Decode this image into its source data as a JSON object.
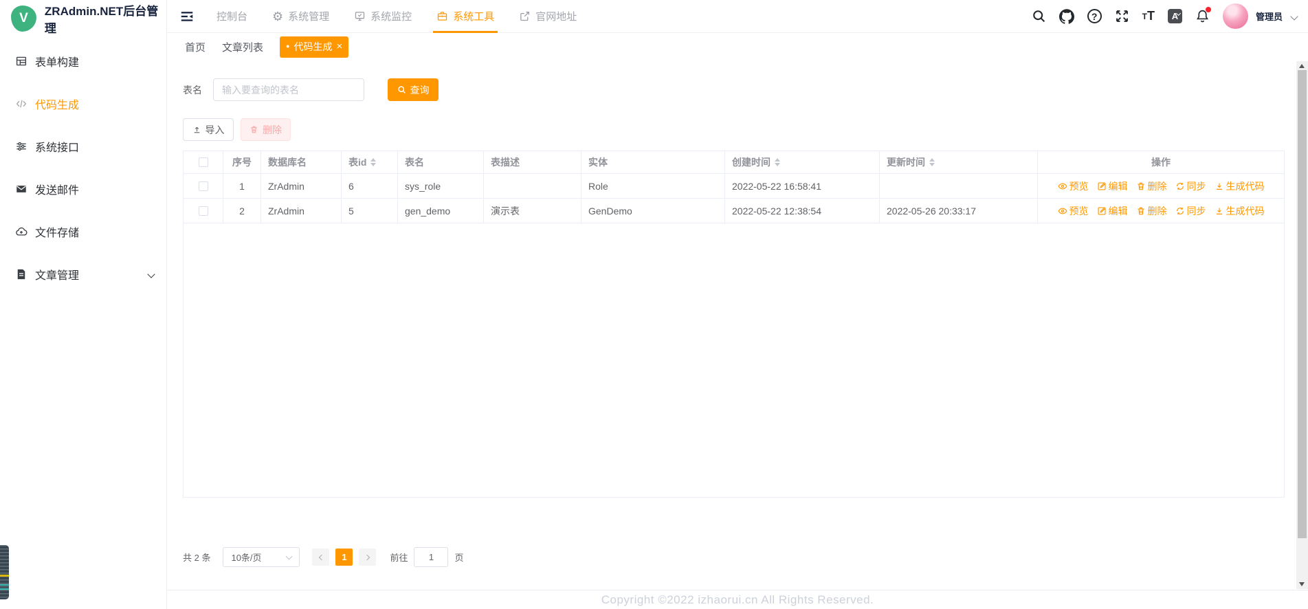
{
  "app": {
    "title": "ZRAdmin.NET后台管理",
    "logo_letter": "V"
  },
  "colors": {
    "accent": "#ff9800",
    "logo_green": "#3eb37f",
    "danger_soft_bg": "#fef0f0",
    "danger_soft_text": "#f9a7a7"
  },
  "sidebar": {
    "items": [
      {
        "label": "表单构建",
        "icon": "form-grid-icon",
        "active": false
      },
      {
        "label": "代码生成",
        "icon": "code-icon",
        "active": true
      },
      {
        "label": "系统接口",
        "icon": "sliders-icon",
        "active": false
      },
      {
        "label": "发送邮件",
        "icon": "mail-icon",
        "active": false
      },
      {
        "label": "文件存储",
        "icon": "cloud-upload-icon",
        "active": false
      },
      {
        "label": "文章管理",
        "icon": "document-icon",
        "active": false,
        "expandable": true
      }
    ]
  },
  "header": {
    "nav": [
      {
        "label": "控制台",
        "active": false
      },
      {
        "label": "系统管理",
        "icon": "gear-icon",
        "active": false
      },
      {
        "label": "系统监控",
        "icon": "monitor-icon",
        "active": false
      },
      {
        "label": "系统工具",
        "icon": "toolbox-icon",
        "active": true
      },
      {
        "label": "官网地址",
        "icon": "external-link-icon",
        "active": false
      }
    ],
    "right": {
      "user_name": "管理员",
      "has_notification_dot": true
    }
  },
  "tabs": [
    {
      "label": "首页",
      "active": false
    },
    {
      "label": "文章列表",
      "active": false
    },
    {
      "label": "代码生成",
      "active": true,
      "dot_glyph": "●",
      "close_glyph": "×"
    }
  ],
  "filter": {
    "table_name_label": "表名",
    "table_name_placeholder": "输入要查询的表名",
    "table_name_value": "",
    "search_button": "查询"
  },
  "toolbar": {
    "import_button": "导入",
    "delete_button": "删除"
  },
  "table": {
    "columns": [
      "",
      "序号",
      "数据库名",
      "表id",
      "表名",
      "表描述",
      "实体",
      "创建时间",
      "更新时间",
      "操作"
    ],
    "sortable_columns": [
      "表id",
      "创建时间",
      "更新时间"
    ],
    "rows": [
      {
        "seq": "1",
        "db": "ZrAdmin",
        "table_id": "6",
        "name": "sys_role",
        "desc": "",
        "entity": "Role",
        "created": "2022-05-22 16:58:41",
        "updated": ""
      },
      {
        "seq": "2",
        "db": "ZrAdmin",
        "table_id": "5",
        "name": "gen_demo",
        "desc": "演示表",
        "entity": "GenDemo",
        "created": "2022-05-22 12:38:54",
        "updated": "2022-05-26 20:33:17"
      }
    ],
    "actions": [
      "预览",
      "编辑",
      "删除",
      "同步",
      "生成代码"
    ]
  },
  "pagination": {
    "total_text": "共 2 条",
    "page_size_text": "10条/页",
    "current_page": "1",
    "goto_label": "前往",
    "goto_value": "1",
    "page_unit": "页"
  },
  "footer": {
    "copyright": "Copyright ©2022 izhaorui.cn All Rights Reserved."
  }
}
